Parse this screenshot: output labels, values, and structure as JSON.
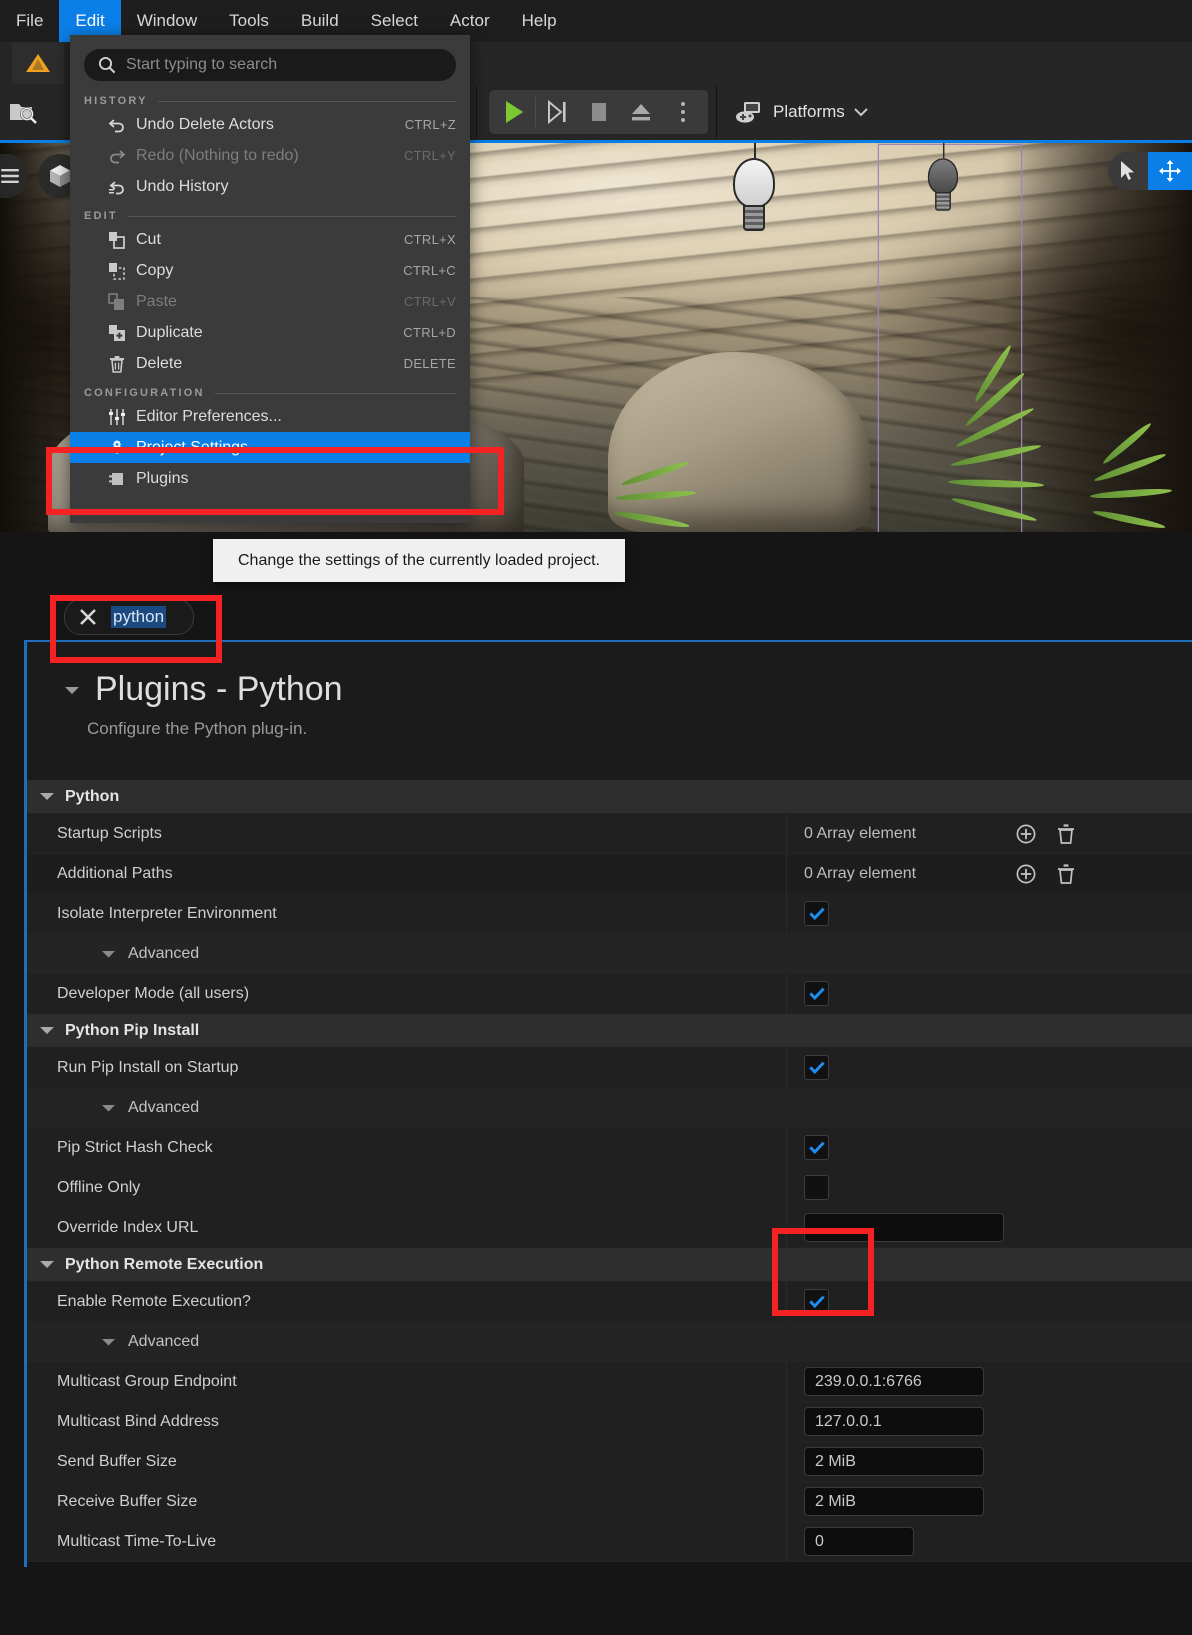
{
  "menubar": {
    "items": [
      {
        "label": "File",
        "active": false
      },
      {
        "label": "Edit",
        "active": true
      },
      {
        "label": "Window",
        "active": false
      },
      {
        "label": "Tools",
        "active": false
      },
      {
        "label": "Build",
        "active": false
      },
      {
        "label": "Select",
        "active": false
      },
      {
        "label": "Actor",
        "active": false
      },
      {
        "label": "Help",
        "active": false
      }
    ]
  },
  "toolbar": {
    "platforms_label": "Platforms",
    "icons": [
      "warning-icon",
      "content-browser-icon",
      "cinematics-icon",
      "play-icon",
      "skip-icon",
      "stop-icon",
      "eject-icon",
      "more-options-icon",
      "gamepad-icon"
    ]
  },
  "edit_menu": {
    "search_placeholder": "Start typing to search",
    "sections": [
      {
        "label": "HISTORY",
        "items": [
          {
            "icon": "undo-icon",
            "label": "Undo Delete Actors",
            "shortcut": "CTRL+Z",
            "disabled": false,
            "selected": false
          },
          {
            "icon": "redo-icon",
            "label": "Redo (Nothing to redo)",
            "shortcut": "CTRL+Y",
            "disabled": true,
            "selected": false
          },
          {
            "icon": "undo-history-icon",
            "label": "Undo History",
            "shortcut": "",
            "disabled": false,
            "selected": false
          }
        ]
      },
      {
        "label": "EDIT",
        "items": [
          {
            "icon": "cut-icon",
            "label": "Cut",
            "shortcut": "CTRL+X",
            "disabled": false,
            "selected": false
          },
          {
            "icon": "copy-icon",
            "label": "Copy",
            "shortcut": "CTRL+C",
            "disabled": false,
            "selected": false
          },
          {
            "icon": "paste-icon",
            "label": "Paste",
            "shortcut": "CTRL+V",
            "disabled": true,
            "selected": false
          },
          {
            "icon": "duplicate-icon",
            "label": "Duplicate",
            "shortcut": "CTRL+D",
            "disabled": false,
            "selected": false
          },
          {
            "icon": "delete-icon",
            "label": "Delete",
            "shortcut": "DELETE",
            "disabled": false,
            "selected": false
          }
        ]
      },
      {
        "label": "CONFIGURATION",
        "items": [
          {
            "icon": "sliders-icon",
            "label": "Editor Preferences...",
            "shortcut": "",
            "disabled": false,
            "selected": false
          },
          {
            "icon": "project-settings-icon",
            "label": "Project Settings...",
            "shortcut": "",
            "disabled": false,
            "selected": true
          },
          {
            "icon": "plugins-icon",
            "label": "Plugins",
            "shortcut": "",
            "disabled": false,
            "selected": false
          }
        ]
      }
    ]
  },
  "tooltip": {
    "text": "Change the settings of the currently loaded project."
  },
  "settings": {
    "search_value": "python",
    "page_title": "Plugins - Python",
    "page_subtitle": "Configure the Python plug-in.",
    "array_element_text": "0 Array element",
    "advanced_label": "Advanced",
    "sections": [
      {
        "name": "Python",
        "rows": [
          {
            "label": "Startup Scripts",
            "type": "array",
            "value": "0 Array element",
            "indent": false
          },
          {
            "label": "Additional Paths",
            "type": "array",
            "value": "0 Array element",
            "indent": false
          },
          {
            "label": "Isolate Interpreter Environment",
            "type": "checkbox",
            "value": true,
            "indent": false
          },
          {
            "label": "Advanced",
            "type": "advanced",
            "value": "",
            "indent": true
          },
          {
            "label": "Developer Mode (all users)",
            "type": "checkbox",
            "value": true,
            "indent": false
          }
        ]
      },
      {
        "name": "Python Pip Install",
        "rows": [
          {
            "label": "Run Pip Install on Startup",
            "type": "checkbox",
            "value": true,
            "indent": false
          },
          {
            "label": "Advanced",
            "type": "advanced",
            "value": "",
            "indent": true
          },
          {
            "label": "Pip Strict Hash Check",
            "type": "checkbox",
            "value": true,
            "indent": false
          },
          {
            "label": "Offline Only",
            "type": "checkbox",
            "value": false,
            "indent": false
          },
          {
            "label": "Override Index URL",
            "type": "textwide",
            "value": "",
            "indent": false
          }
        ]
      },
      {
        "name": "Python Remote Execution",
        "rows": [
          {
            "label": "Enable Remote Execution?",
            "type": "checkbox",
            "value": true,
            "indent": false
          },
          {
            "label": "Advanced",
            "type": "advanced",
            "value": "",
            "indent": true
          },
          {
            "label": "Multicast Group Endpoint",
            "type": "text",
            "value": "239.0.0.1:6766",
            "indent": false
          },
          {
            "label": "Multicast Bind Address",
            "type": "text",
            "value": "127.0.0.1",
            "indent": false
          },
          {
            "label": "Send Buffer Size",
            "type": "text",
            "value": "2 MiB",
            "indent": false
          },
          {
            "label": "Receive Buffer Size",
            "type": "text",
            "value": "2 MiB",
            "indent": false
          },
          {
            "label": "Multicast Time-To-Live",
            "type": "textnarrow",
            "value": "0",
            "indent": false
          }
        ]
      }
    ]
  },
  "colors": {
    "accent_blue": "#0b7fe8",
    "annotation_red": "#f42222",
    "panel_bg": "#202020",
    "category_bg": "#2e2e2e",
    "checkbox_check": "#1f8ef1"
  }
}
